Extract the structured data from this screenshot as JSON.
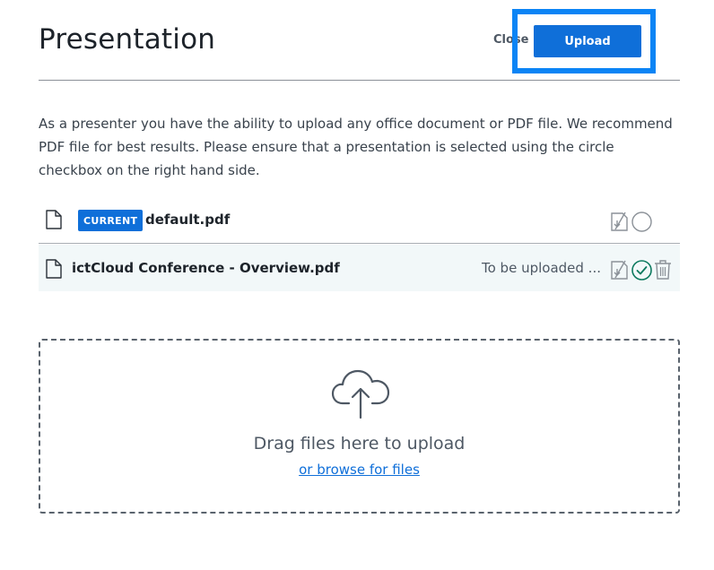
{
  "header": {
    "title": "Presentation",
    "close_label": "Close",
    "upload_label": "Upload"
  },
  "description": "As a presenter you have the ability to upload any office document or PDF file. We recommend PDF file for best results. Please ensure that a presentation is selected using the circle checkbox on the right hand side.",
  "files": [
    {
      "badge": "CURRENT",
      "name": "default.pdf",
      "status": "",
      "selected": false,
      "icons": [
        "document-icon",
        "download-toggle-icon",
        "select-circle-icon"
      ]
    },
    {
      "badge": "",
      "name": "ictCloud Conference - Overview.pdf",
      "status": "To be uploaded ...",
      "selected": true,
      "icons": [
        "document-icon",
        "download-toggle-icon",
        "selected-check-icon",
        "trash-icon"
      ]
    }
  ],
  "dropzone": {
    "icon": "cloud-upload-icon",
    "text": "Drag files here to upload",
    "browse_label": "or browse for files"
  },
  "colors": {
    "primary": "#0f6fd9",
    "focus_ring": "#0b84f5",
    "success": "#0d7a5f",
    "muted_icon": "#8b9198"
  }
}
